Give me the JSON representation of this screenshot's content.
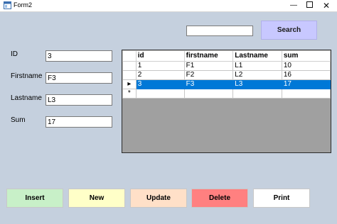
{
  "window": {
    "title": "Form2"
  },
  "colors": {
    "background": "#c5d0de",
    "search": "#c8c8ff",
    "insert": "#c8f0c8",
    "new": "#ffffc8",
    "update": "#ffe0c8",
    "delete": "#ff8080",
    "print": "#ffffff",
    "selection": "#0078d7"
  },
  "form": {
    "id_label": "ID",
    "id_value": "3",
    "firstname_label": "Firstname",
    "firstname_value": "F3",
    "lastname_label": "Lastname",
    "lastname_value": "L3",
    "sum_label": "Sum",
    "sum_value": "17"
  },
  "search": {
    "value": "",
    "button_label": "Search"
  },
  "grid": {
    "columns": [
      "id",
      "firstname",
      "Lastname",
      "sum"
    ],
    "rows": [
      {
        "cells": [
          "1",
          "F1",
          "L1",
          "10"
        ],
        "selected": false
      },
      {
        "cells": [
          "2",
          "F2",
          "L2",
          "16"
        ],
        "selected": false
      },
      {
        "cells": [
          "3",
          "F3",
          "L3",
          "17"
        ],
        "selected": true
      }
    ],
    "current_row_marker": "▸",
    "new_row_marker": "*"
  },
  "buttons": {
    "insert": "Insert",
    "new": "New",
    "update": "Update",
    "delete": "Delete",
    "print": "Print"
  }
}
